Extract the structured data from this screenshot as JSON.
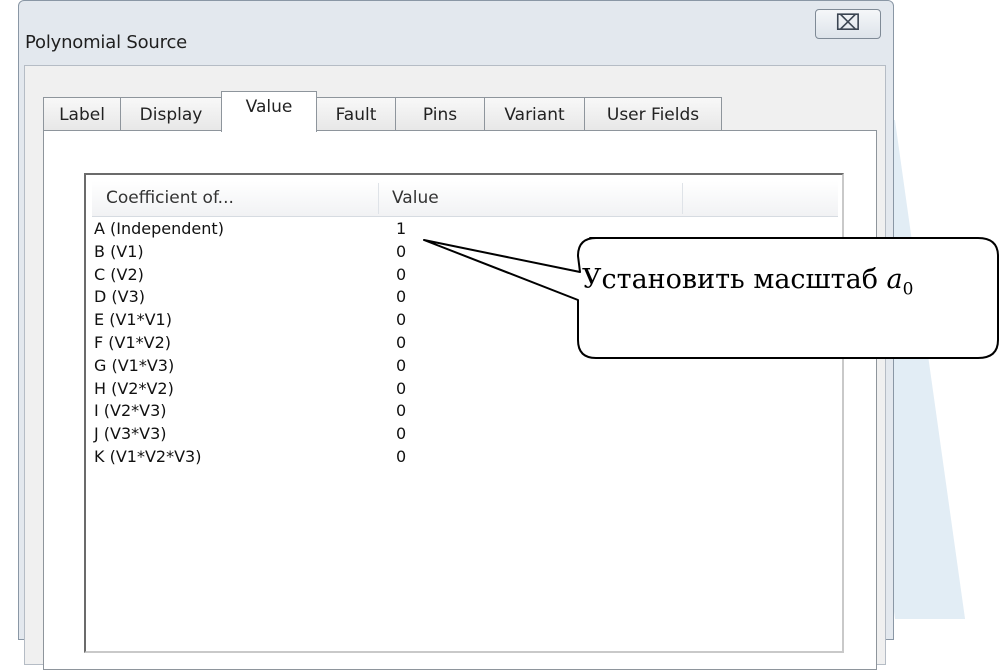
{
  "window": {
    "title": "Polynomial Source",
    "close_glyph": "⌧",
    "close_icon": "close-icon"
  },
  "tabs": [
    {
      "label": "Label",
      "active": false
    },
    {
      "label": "Display",
      "active": false
    },
    {
      "label": "Value",
      "active": true
    },
    {
      "label": "Fault",
      "active": false
    },
    {
      "label": "Pins",
      "active": false
    },
    {
      "label": "Variant",
      "active": false
    },
    {
      "label": "User Fields",
      "active": false
    }
  ],
  "table": {
    "columns": [
      "Coefficient of...",
      "Value"
    ],
    "rows": [
      {
        "coefficient": "A (Independent)",
        "value": "1"
      },
      {
        "coefficient": "B (V1)",
        "value": "0"
      },
      {
        "coefficient": "C (V2)",
        "value": "0"
      },
      {
        "coefficient": "D (V3)",
        "value": "0"
      },
      {
        "coefficient": "E (V1*V1)",
        "value": "0"
      },
      {
        "coefficient": "F (V1*V2)",
        "value": "0"
      },
      {
        "coefficient": "G (V1*V3)",
        "value": "0"
      },
      {
        "coefficient": "H (V2*V2)",
        "value": "0"
      },
      {
        "coefficient": "I (V2*V3)",
        "value": "0"
      },
      {
        "coefficient": "J (V3*V3)",
        "value": "0"
      },
      {
        "coefficient": "K (V1*V2*V3)",
        "value": "0"
      }
    ]
  },
  "callout": {
    "text": "Установить масштаб ",
    "symbol": "a",
    "subscript": "0"
  },
  "colors": {
    "dialog_frame": "#e3e8ee",
    "watermark": "#e2edf5",
    "panel": "#ffffff"
  }
}
